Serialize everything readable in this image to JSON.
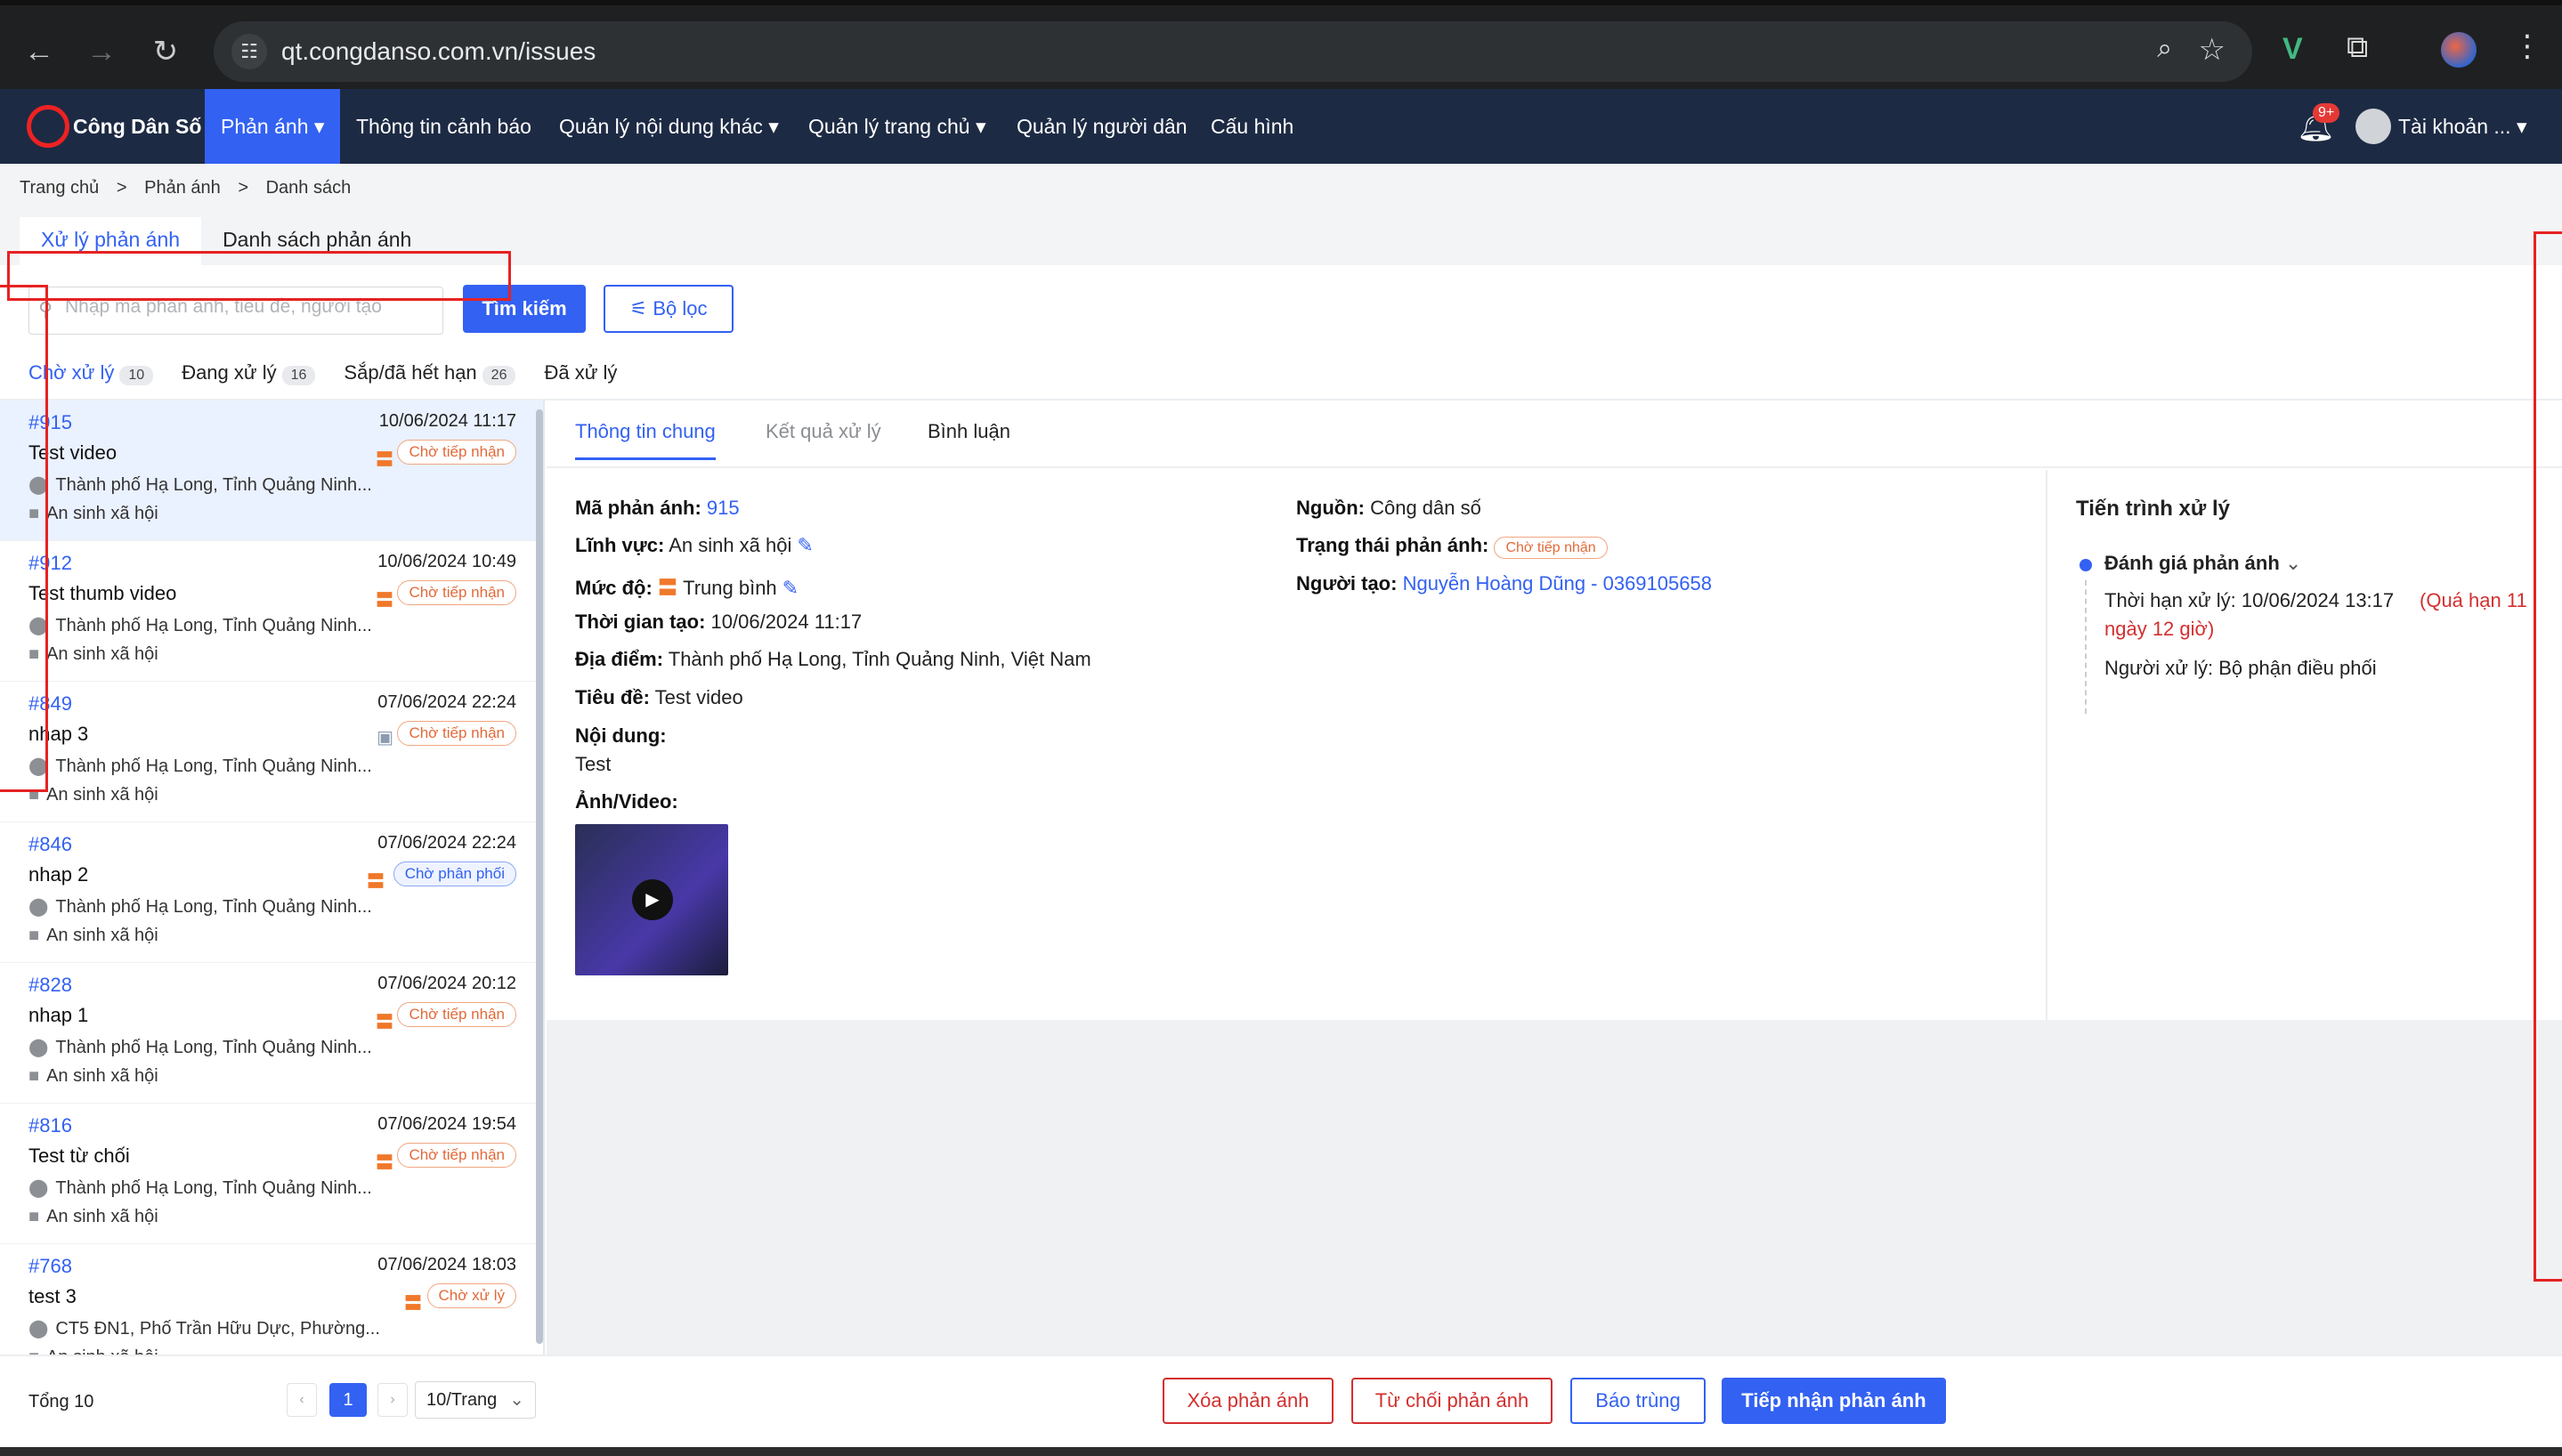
{
  "browser": {
    "url": "qt.congdanso.com.vn/issues"
  },
  "app": {
    "logo_text": "Công Dân Số",
    "nav": [
      "Phản ánh ▾",
      "Thông tin cảnh báo",
      "Quản lý nội dung khác ▾",
      "Quản lý trang chủ ▾",
      "Quản lý người dân",
      "Cấu hình"
    ],
    "notif_badge": "9+",
    "account": "Tài khoản ... ▾"
  },
  "breadcrumb": [
    "Trang chủ",
    ">",
    "Phản ánh",
    ">",
    "Danh sách"
  ],
  "top_tabs": [
    "Xử lý phản ánh",
    "Danh sách phản ánh"
  ],
  "search": {
    "placeholder": "Nhập mã phản ánh, tiêu đề, người tạo",
    "button": "Tìm kiếm",
    "filter": "Bộ lọc"
  },
  "status_tabs": [
    {
      "label": "Chờ xử lý",
      "count": "10"
    },
    {
      "label": "Đang xử lý",
      "count": "16"
    },
    {
      "label": "Sắp/đã hết hạn",
      "count": "26"
    },
    {
      "label": "Đã xử lý",
      "count": ""
    }
  ],
  "items": [
    {
      "id": "#915",
      "date": "10/06/2024 11:17",
      "title": "Test video",
      "status": "Chờ tiếp nhận",
      "location": "Thành phố Hạ Long, Tỉnh Quảng Ninh...",
      "category": "An sinh xã hội"
    },
    {
      "id": "#912",
      "date": "10/06/2024 10:49",
      "title": "Test thumb video",
      "status": "Chờ tiếp nhận",
      "location": "Thành phố Hạ Long, Tỉnh Quảng Ninh...",
      "category": "An sinh xã hội"
    },
    {
      "id": "#849",
      "date": "07/06/2024 22:24",
      "title": "nhap 3",
      "status": "Chờ tiếp nhận",
      "location": "Thành phố Hạ Long, Tỉnh Quảng Ninh...",
      "category": "An sinh xã hội"
    },
    {
      "id": "#846",
      "date": "07/06/2024 22:24",
      "title": "nhap 2",
      "status": "Chờ phân phối",
      "location": "Thành phố Hạ Long, Tỉnh Quảng Ninh...",
      "category": "An sinh xã hội"
    },
    {
      "id": "#828",
      "date": "07/06/2024 20:12",
      "title": "nhap 1",
      "status": "Chờ tiếp nhận",
      "location": "Thành phố Hạ Long, Tỉnh Quảng Ninh...",
      "category": "An sinh xã hội"
    },
    {
      "id": "#816",
      "date": "07/06/2024 19:54",
      "title": "Test từ chối",
      "status": "Chờ tiếp nhận",
      "location": "Thành phố Hạ Long, Tỉnh Quảng Ninh...",
      "category": "An sinh xã hội"
    },
    {
      "id": "#768",
      "date": "07/06/2024 18:03",
      "title": "test 3",
      "status": "Chờ xử lý",
      "location": "CT5 ĐN1, Phố Trần Hữu Dực, Phường...",
      "category": "An sinh xã hội"
    }
  ],
  "detail_tabs": [
    "Thông tin chung",
    "Kết quả xử lý",
    "Bình luận"
  ],
  "detail": {
    "ma_label": "Mã phản ánh:",
    "ma_value": "915",
    "linhvuc_label": "Lĩnh vực:",
    "linhvuc_value": "An sinh xã hội",
    "mucdo_label": "Mức độ:",
    "mucdo_value": "Trung bình",
    "thoigian_label": "Thời gian tạo:",
    "thoigian_value": "10/06/2024 11:17",
    "diadiem_label": "Địa điểm:",
    "diadiem_value": "Thành phố Hạ Long, Tỉnh Quảng Ninh, Việt Nam",
    "tieude_label": "Tiêu đề:",
    "tieude_value": "Test video",
    "noidung_label": "Nội dung:",
    "noidung_value": "Test",
    "anh_label": "Ảnh/Video:",
    "nguon_label": "Nguồn:",
    "nguon_value": "Công dân số",
    "trangthai_label": "Trạng thái phản ánh:",
    "trangthai_value": "Chờ tiếp nhận",
    "nguoitao_label": "Người tạo:",
    "nguoitao_value": "Nguyễn Hoàng Dũng - 0369105658"
  },
  "progress": {
    "title": "Tiến trình xử lý",
    "step": "Đánh giá phản ánh",
    "deadline": "Thời hạn xử lý: 10/06/2024 13:17",
    "overdue": "(Quá hạn 11 ngày 12 giờ)",
    "handler": "Người xử lý: Bộ phận điều phối"
  },
  "footer": {
    "total": "Tổng 10",
    "page": "1",
    "page_size": "10/Trang"
  },
  "actions": [
    "Xóa phản ánh",
    "Từ chối phản ánh",
    "Báo trùng",
    "Tiếp nhận phản ánh"
  ],
  "colors": {
    "primary": "#3361f2",
    "nav_bg": "#1d2a44",
    "danger": "#d32f2f",
    "warning": "#f0782a"
  }
}
